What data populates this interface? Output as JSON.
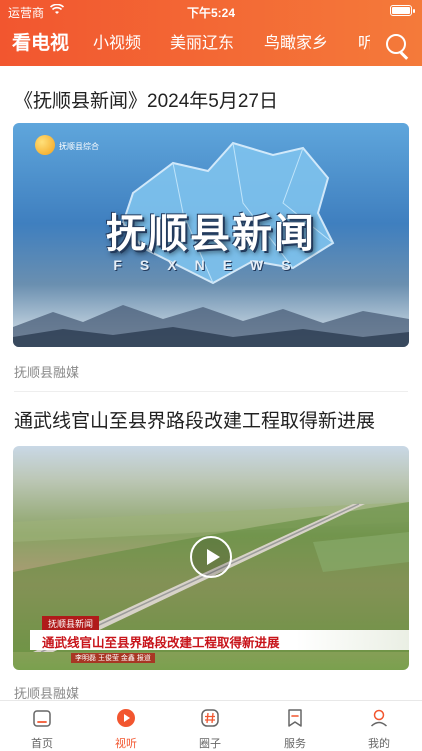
{
  "status_bar": {
    "carrier": "运营商",
    "time": "下午5:24"
  },
  "header": {
    "tabs": [
      {
        "label": "看电视",
        "active": true
      },
      {
        "label": "小视频",
        "active": false
      },
      {
        "label": "美丽辽东",
        "active": false
      },
      {
        "label": "鸟瞰家乡",
        "active": false
      },
      {
        "label": "听",
        "active": false
      }
    ],
    "search_icon": "search-icon",
    "accent_color": "#f2562f"
  },
  "feed": [
    {
      "title": "《抚顺县新闻》2024年5月27日",
      "source": "抚顺县融媒",
      "thumbnail": {
        "channel_logo_text": "抚顺县综合",
        "show_title": "抚顺县新闻",
        "show_subtitle": "FSXNEWS"
      }
    },
    {
      "title": "通武线官山至县界路段改建工程取得新进展",
      "source": "抚顺县融媒",
      "thumbnail": {
        "tag": "抚顺县新闻",
        "caption": "通武线官山至县界路段改建工程取得新进展",
        "credit": "李明磊 王俊莹 金鑫 报道",
        "play_icon": "play-icon"
      }
    }
  ],
  "tabbar": {
    "items": [
      {
        "label": "首页",
        "icon": "home-icon",
        "active": false
      },
      {
        "label": "视听",
        "icon": "play-circle-icon",
        "active": true
      },
      {
        "label": "圈子",
        "icon": "hashtag-icon",
        "active": false
      },
      {
        "label": "服务",
        "icon": "bookmark-icon",
        "active": false
      },
      {
        "label": "我的",
        "icon": "user-icon",
        "active": false
      }
    ]
  }
}
